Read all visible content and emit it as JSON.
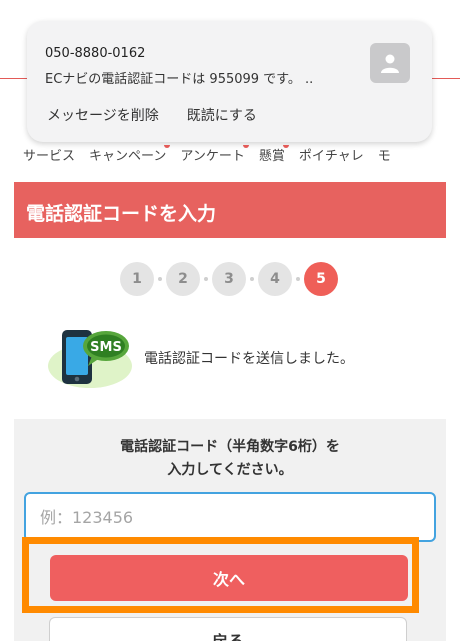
{
  "notification": {
    "sender": "050-8880-0162",
    "message": "ECナビの電話認証コードは 955099 です。 ..",
    "actions": [
      "メッセージを削除",
      "既読にする"
    ]
  },
  "nav": {
    "categories": [
      "サービス",
      "キャンペーン",
      "アンケート",
      "懸賞",
      "ポイチャレ",
      "モ"
    ]
  },
  "page": {
    "title": "電話認証コードを入力"
  },
  "steps": {
    "items": [
      "1",
      "2",
      "3",
      "4",
      "5"
    ],
    "current": 5
  },
  "sms": {
    "icon_label": "SMS",
    "message": "電話認証コードを送信しました。"
  },
  "form": {
    "instruction_line1": "電話認証コード（半角数字6桁）を",
    "instruction_line2": "入力してください。",
    "code_placeholder": "例：123456",
    "next_label": "次へ",
    "back_label": "戻る"
  },
  "colors": {
    "accent": "#e7625f",
    "step_active": "#ef5f58",
    "highlight": "#ff8a00",
    "input_border": "#43a3e0"
  }
}
